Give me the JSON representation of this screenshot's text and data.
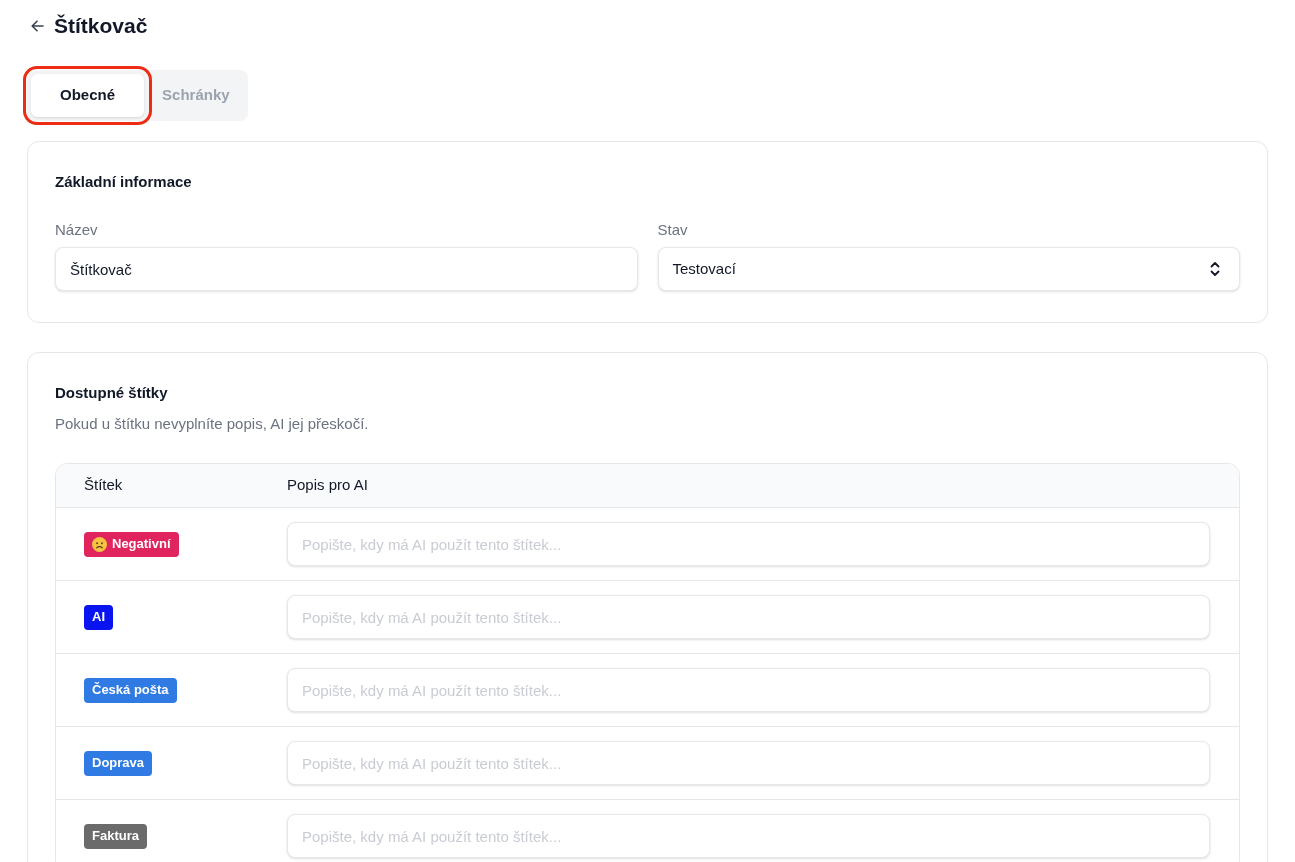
{
  "header": {
    "title": "Štítkovač"
  },
  "tabs": [
    {
      "label": "Obecné",
      "selected": true,
      "highlighted": true
    },
    {
      "label": "Schránky",
      "selected": false,
      "highlighted": false
    }
  ],
  "basic_info": {
    "title": "Základní informace",
    "fields": [
      {
        "kind": "text",
        "label": "Název",
        "value": "Štítkovač"
      },
      {
        "kind": "select",
        "label": "Stav",
        "value": "Testovací"
      }
    ]
  },
  "tags_section": {
    "title": "Dostupné štítky",
    "description": "Pokud u štítku nevyplníte popis, AI jej přeskočí.",
    "table": {
      "columns": [
        "Štítek",
        "Popis pro AI"
      ],
      "rows": [
        {
          "tag": {
            "label": "Negativní",
            "color": "#e0245e",
            "face_icon": true
          },
          "placeholder": "Popište, kdy má AI použít tento štítek..."
        },
        {
          "tag": {
            "label": "AI",
            "color": "#0a14f0",
            "face_icon": false
          },
          "placeholder": "Popište, kdy má AI použít tento štítek..."
        },
        {
          "tag": {
            "label": "Česká pošta",
            "color": "#2f7be3",
            "face_icon": false
          },
          "placeholder": "Popište, kdy má AI použít tento štítek..."
        },
        {
          "tag": {
            "label": "Doprava",
            "color": "#2f7be3",
            "face_icon": false
          },
          "placeholder": "Popište, kdy má AI použít tento štítek..."
        },
        {
          "tag": {
            "label": "Faktura",
            "color": "#6b6b6b",
            "face_icon": false
          },
          "placeholder": "Popište, kdy má AI použít tento štítek..."
        }
      ]
    }
  }
}
